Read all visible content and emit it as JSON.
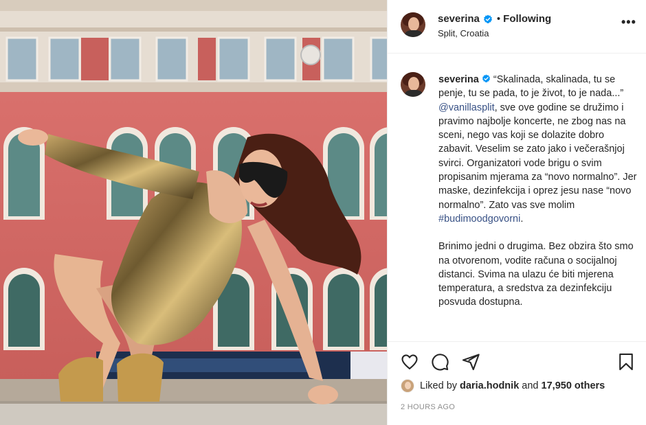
{
  "post": {
    "username": "severina",
    "follow_status": "Following",
    "separator": "•",
    "location": "Split, Croatia",
    "more_label": "•••"
  },
  "caption": {
    "username": "severina",
    "text_1": "“Skalinada, skalinada, tu se penje, tu se pada, to je život, to je nada...” ",
    "mention": "@vanillasplit",
    "text_2": ", sve ove godine se družimo i pravimo najbolje koncerte, ne zbog nas na sceni, nego vas koji se dolazite dobro zabavit. Veselim se zato jako i večerašnjoj svirci. Organizatori vode brigu o svim propisanim mjerama za “novo normalno”. Jer maske, dezinfekcija i oprez jesu nase “novo normalno”. Zato vas sve molim ",
    "hashtag": "#budimoodgovorni",
    "text_3": ".",
    "paragraph_2": "Brinimo jedni o drugima. Bez obzira što smo na otvorenom, vodite računa o socijalnoj distanci. Svima na ulazu će biti mjerena temperatura, a sredstva za dezinfekciju posvuda dostupna."
  },
  "likes": {
    "prefix": "Liked by ",
    "user": "daria.hodnik",
    "middle": " and ",
    "count": "17,950 others"
  },
  "timestamp": "2 HOURS AGO",
  "icons": {
    "like": "heart-icon",
    "comment": "comment-icon",
    "share": "paper-plane-icon",
    "save": "bookmark-icon",
    "verified": "verified-badge-icon",
    "more": "more-options-icon"
  },
  "colors": {
    "text": "#262626",
    "link": "#385185",
    "muted": "#8e8e8e",
    "verified": "#0095f6",
    "border": "#efefef"
  }
}
